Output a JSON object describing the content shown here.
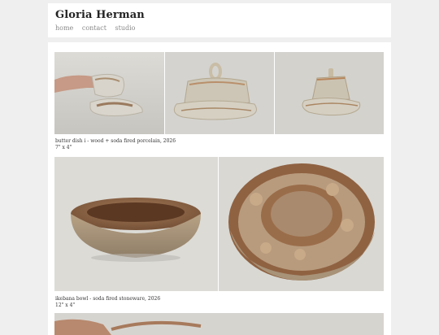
{
  "header": {
    "title": "Gloria Herman",
    "nav": [
      "home",
      "contact",
      "studio"
    ]
  },
  "gallery": [
    {
      "caption_line1": "butter dish i - wood + soda fired porcelain, 2026",
      "caption_line2": "7\" x 4\""
    },
    {
      "caption_line1": "ikebana bowl - soda fired stoneware, 2026",
      "caption_line2": "12\" x 4\""
    }
  ],
  "colors": {
    "page_bg": "#efefef",
    "card_bg": "#ffffff",
    "nav_text": "#8a8a8a"
  }
}
